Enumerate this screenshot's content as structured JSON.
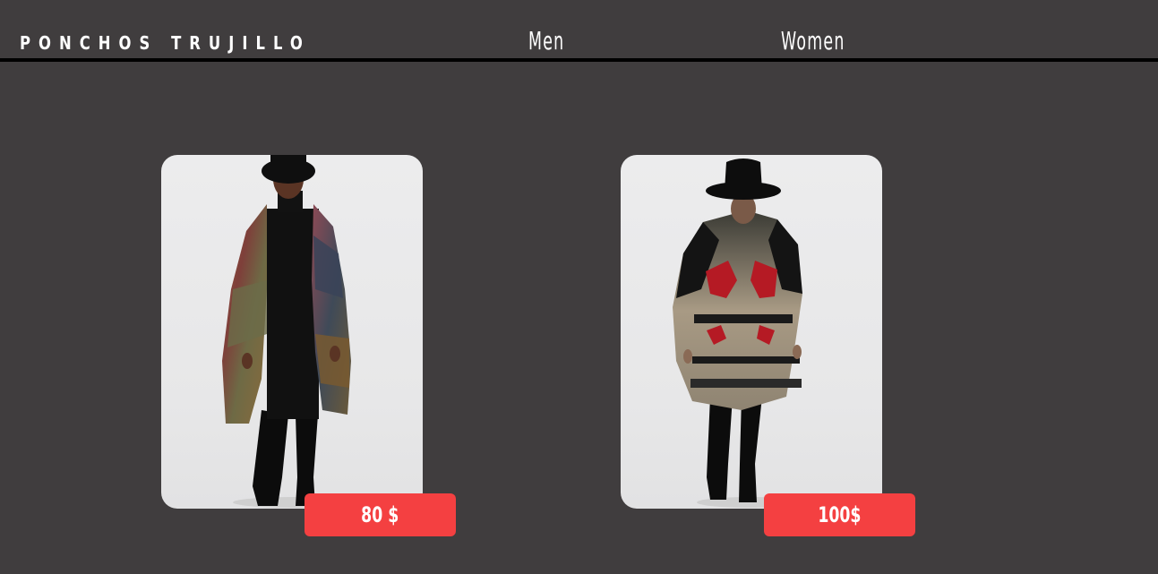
{
  "header": {
    "brand": "PONCHOS TRUJILLO",
    "nav": [
      {
        "label": "Men"
      },
      {
        "label": "Women"
      }
    ]
  },
  "products": [
    {
      "price": "80 $",
      "image": "man-in-brown-patchwork-poncho"
    },
    {
      "price": "100$",
      "image": "man-in-aztec-pattern-poncho"
    }
  ],
  "colors": {
    "background": "#403d3e",
    "accent": "#f44041",
    "rule": "#000000",
    "text": "#ffffff"
  }
}
